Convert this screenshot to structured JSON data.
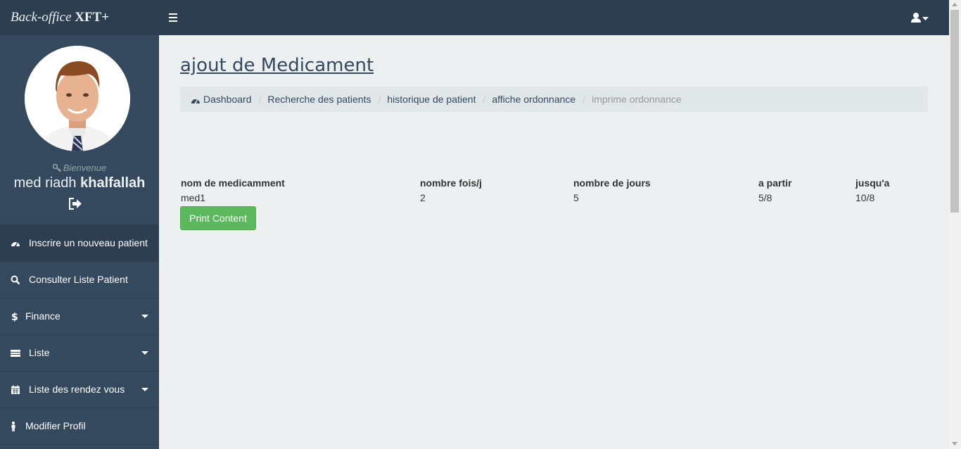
{
  "brand": {
    "italic": "Back-office",
    "bold": "XFT+"
  },
  "sidebar": {
    "welcome": "Bienvenue",
    "user_first": "med riadh",
    "user_last": "khalfallah",
    "items": [
      {
        "label": "Inscrire un nouveau patient",
        "icon": "dashboard-icon",
        "has_caret": false
      },
      {
        "label": "Consulter Liste Patient",
        "icon": "search-icon",
        "has_caret": false
      },
      {
        "label": "Finance",
        "icon": "dollar-icon",
        "has_caret": true
      },
      {
        "label": "Liste",
        "icon": "list-icon",
        "has_caret": true
      },
      {
        "label": "Liste des rendez vous",
        "icon": "calendar-icon",
        "has_caret": true
      },
      {
        "label": "Modifier Profil",
        "icon": "male-icon",
        "has_caret": false
      }
    ]
  },
  "main": {
    "title": "ajout de Medicament",
    "breadcrumb": [
      "Dashboard",
      "Recherche des patients",
      "historique de patient",
      "affiche ordonnance",
      "imprime ordonnance"
    ],
    "table": {
      "headers": [
        "nom de medicamment",
        "nombre fois/j",
        "nombre de jours",
        "a partir",
        "jusqu'a"
      ],
      "rows": [
        [
          "med1",
          "2",
          "5",
          "5/8",
          "10/8"
        ]
      ]
    },
    "print_button": "Print Content"
  },
  "colors": {
    "topbar": "#2c3e50",
    "sidebar": "#34495e",
    "content_bg": "#ecf0f1",
    "button_success": "#5cb85c"
  }
}
